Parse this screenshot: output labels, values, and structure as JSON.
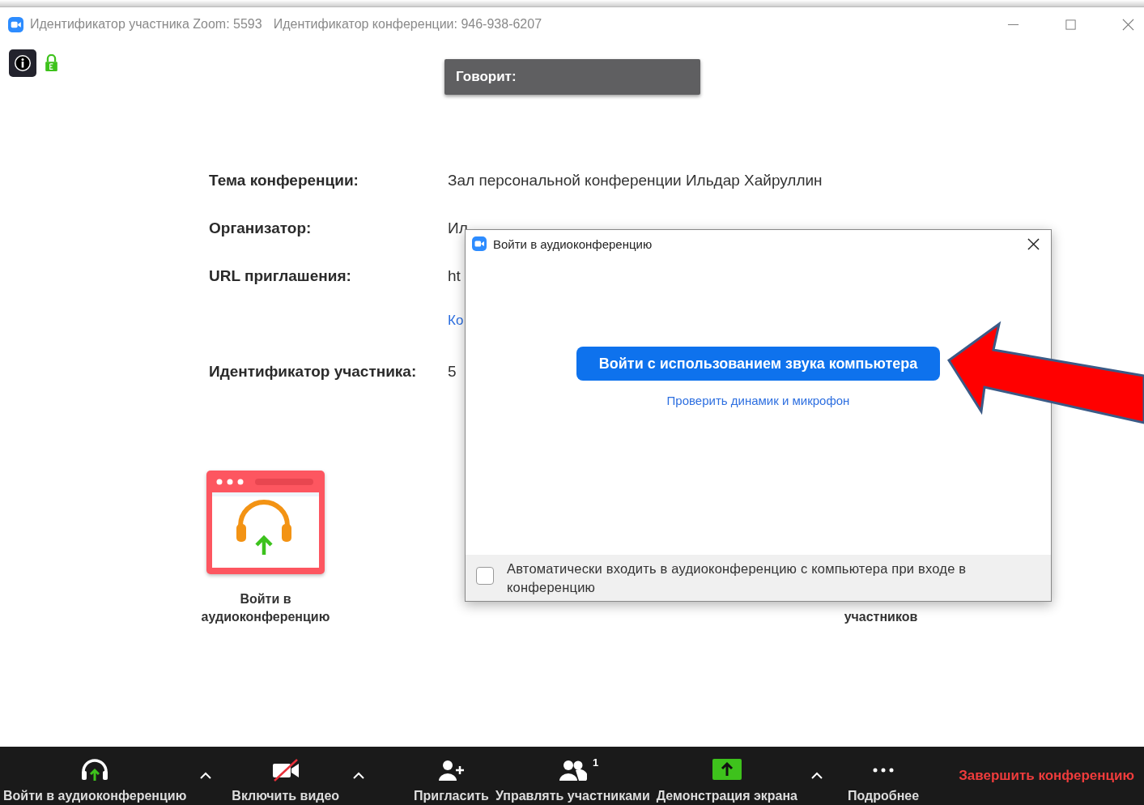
{
  "window": {
    "title": "Идентификатор участника Zoom: 5593",
    "conference_id": "Идентификатор конференции: 946-938-6207"
  },
  "speaking_label": "Говорит:",
  "info": [
    {
      "label": "Тема конференции:",
      "value": "Зал персональной конференции Ильдар Хайруллин"
    },
    {
      "label": "Организатор:",
      "value": "Ил"
    },
    {
      "label": "URL приглашения:",
      "value": "ht",
      "link": "Ко"
    },
    {
      "label": "Идентификатор участника:",
      "value": "5"
    }
  ],
  "audio_tile": {
    "label": "Войти в аудиоконференцию"
  },
  "invite_tile": {
    "label": "участников"
  },
  "dialog": {
    "title": "Войти в аудиоконференцию",
    "primary_button": "Войти с использованием звука компьютера",
    "test_link": "Проверить динамик и микрофон",
    "auto_join": {
      "label": "Автоматически входить в аудиоконференцию с компьютера при входе в конференцию",
      "checked": false
    }
  },
  "toolbar": {
    "items": [
      {
        "label": "Войти в аудиоконференцию",
        "kind": "audio",
        "caret": true
      },
      {
        "label": "Включить видео",
        "kind": "video",
        "caret": true
      },
      {
        "label": "Пригласить",
        "kind": "invite",
        "caret": false
      },
      {
        "label": "Управлять участниками",
        "kind": "participants",
        "badge": "1",
        "caret": false
      },
      {
        "label": "Демонстрация экрана",
        "kind": "share",
        "caret": true
      },
      {
        "label": "Подробнее",
        "kind": "more",
        "caret": false
      }
    ],
    "end_button": "Завершить конференцию"
  }
}
